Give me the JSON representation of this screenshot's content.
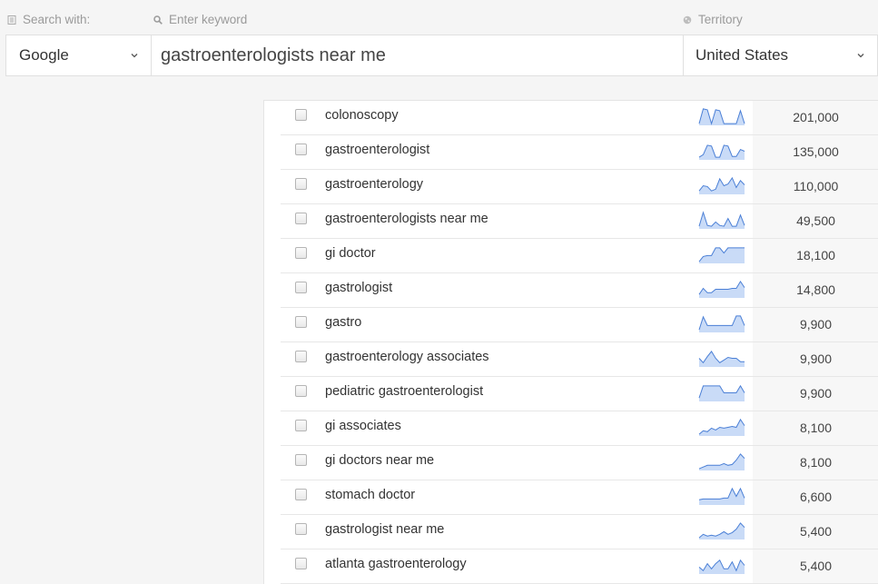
{
  "search_with": {
    "label": "Search with:",
    "icon": "document-icon",
    "value": "Google"
  },
  "keyword": {
    "placeholder": "Enter keyword",
    "icon": "search-icon",
    "value": "gastroenterologists near me"
  },
  "territory": {
    "label": "Territory",
    "icon": "globe-icon",
    "value": "United States"
  },
  "colors": {
    "spark_stroke": "#4a7fd6",
    "spark_fill": "#c9dbf7"
  },
  "rows": [
    {
      "keyword": "colonoscopy",
      "volume": "201,000",
      "trend": [
        0.1,
        0.95,
        0.9,
        0.1,
        0.9,
        0.85,
        0.1,
        0.1,
        0.1,
        0.1,
        0.85,
        0.1
      ]
    },
    {
      "keyword": "gastroenterologist",
      "volume": "135,000",
      "trend": [
        0.15,
        0.3,
        0.85,
        0.8,
        0.15,
        0.15,
        0.85,
        0.8,
        0.2,
        0.2,
        0.6,
        0.5
      ]
    },
    {
      "keyword": "gastroenterology",
      "volume": "110,000",
      "trend": [
        0.2,
        0.5,
        0.45,
        0.2,
        0.3,
        0.9,
        0.5,
        0.6,
        0.95,
        0.4,
        0.8,
        0.55
      ]
    },
    {
      "keyword": "gastroenterologists near me",
      "volume": "49,500",
      "trend": [
        0.15,
        0.95,
        0.2,
        0.15,
        0.4,
        0.2,
        0.15,
        0.6,
        0.15,
        0.15,
        0.8,
        0.2
      ]
    },
    {
      "keyword": "gi doctor",
      "volume": "18,100",
      "trend": [
        0.1,
        0.4,
        0.45,
        0.45,
        0.9,
        0.9,
        0.6,
        0.9,
        0.9,
        0.9,
        0.9,
        0.9
      ]
    },
    {
      "keyword": "gastrologist",
      "volume": "14,800",
      "trend": [
        0.2,
        0.55,
        0.3,
        0.3,
        0.5,
        0.5,
        0.5,
        0.5,
        0.55,
        0.55,
        0.95,
        0.6
      ]
    },
    {
      "keyword": "gastro",
      "volume": "9,900",
      "trend": [
        0.15,
        0.9,
        0.4,
        0.4,
        0.4,
        0.4,
        0.4,
        0.4,
        0.4,
        0.95,
        0.95,
        0.4
      ]
    },
    {
      "keyword": "gastroenterology associates",
      "volume": "9,900",
      "trend": [
        0.5,
        0.25,
        0.6,
        0.9,
        0.5,
        0.25,
        0.4,
        0.55,
        0.5,
        0.5,
        0.3,
        0.3
      ]
    },
    {
      "keyword": "pediatric gastroenterologist",
      "volume": "9,900",
      "trend": [
        0.2,
        0.9,
        0.9,
        0.9,
        0.9,
        0.9,
        0.5,
        0.5,
        0.5,
        0.5,
        0.9,
        0.5
      ]
    },
    {
      "keyword": "gi associates",
      "volume": "8,100",
      "trend": [
        0.1,
        0.3,
        0.25,
        0.45,
        0.35,
        0.5,
        0.45,
        0.5,
        0.55,
        0.5,
        0.95,
        0.6
      ]
    },
    {
      "keyword": "gi doctors near me",
      "volume": "8,100",
      "trend": [
        0.1,
        0.2,
        0.3,
        0.3,
        0.3,
        0.3,
        0.4,
        0.3,
        0.35,
        0.6,
        0.95,
        0.7
      ]
    },
    {
      "keyword": "stomach doctor",
      "volume": "6,600",
      "trend": [
        0.3,
        0.35,
        0.35,
        0.35,
        0.35,
        0.35,
        0.4,
        0.4,
        0.95,
        0.5,
        0.95,
        0.4
      ]
    },
    {
      "keyword": "gastrologist near me",
      "volume": "5,400",
      "trend": [
        0.1,
        0.3,
        0.2,
        0.25,
        0.2,
        0.3,
        0.45,
        0.3,
        0.4,
        0.6,
        0.95,
        0.7
      ]
    },
    {
      "keyword": "atlanta gastroenterology",
      "volume": "5,400",
      "trend": [
        0.4,
        0.2,
        0.6,
        0.3,
        0.6,
        0.8,
        0.3,
        0.3,
        0.7,
        0.2,
        0.8,
        0.5
      ]
    }
  ]
}
